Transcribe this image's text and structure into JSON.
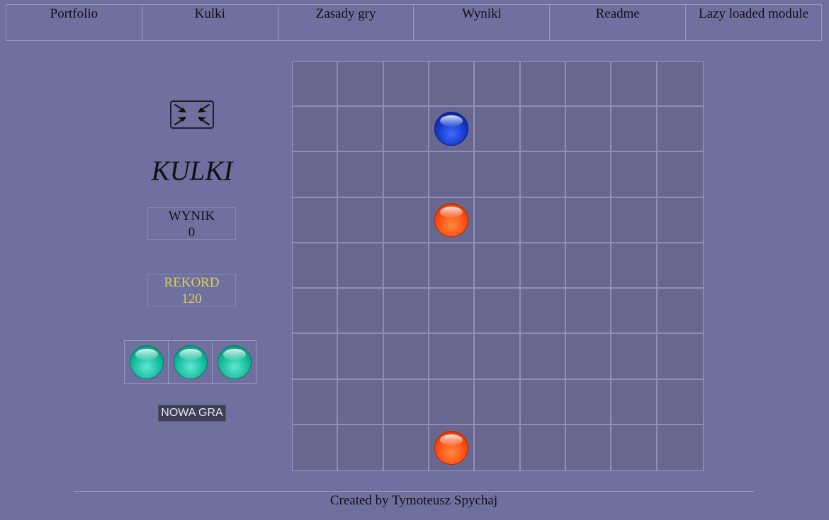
{
  "nav": {
    "items": [
      {
        "label": "Portfolio"
      },
      {
        "label": "Kulki"
      },
      {
        "label": "Zasady gry"
      },
      {
        "label": "Wyniki"
      },
      {
        "label": "Readme"
      },
      {
        "label": "Lazy loaded module"
      }
    ]
  },
  "game": {
    "title": "KULKI",
    "fullscreen_icon": "fullscreen-exit-icon",
    "score": {
      "label": "WYNIK",
      "value": "0"
    },
    "record": {
      "label": "REKORD",
      "value": "120"
    },
    "next_balls": [
      {
        "color": "teal"
      },
      {
        "color": "teal"
      },
      {
        "color": "teal"
      }
    ],
    "new_game_label": "NOWA GRA",
    "board": {
      "rows": 9,
      "cols": 9,
      "balls": [
        {
          "row": 2,
          "col": 4,
          "color": "blue"
        },
        {
          "row": 4,
          "col": 4,
          "color": "red"
        },
        {
          "row": 9,
          "col": 4,
          "color": "red"
        }
      ]
    },
    "ball_colors": {
      "blue": {
        "light": "#3f6bff",
        "mid": "#1236c4",
        "dark": "#0a1f7a"
      },
      "red": {
        "light": "#ff8a3d",
        "mid": "#ff4a10",
        "dark": "#b82a00"
      },
      "teal": {
        "light": "#5fe9cf",
        "mid": "#11b89a",
        "dark": "#0a7a66"
      }
    }
  },
  "footer": {
    "text": "Created by Tymoteusz Spychaj"
  }
}
